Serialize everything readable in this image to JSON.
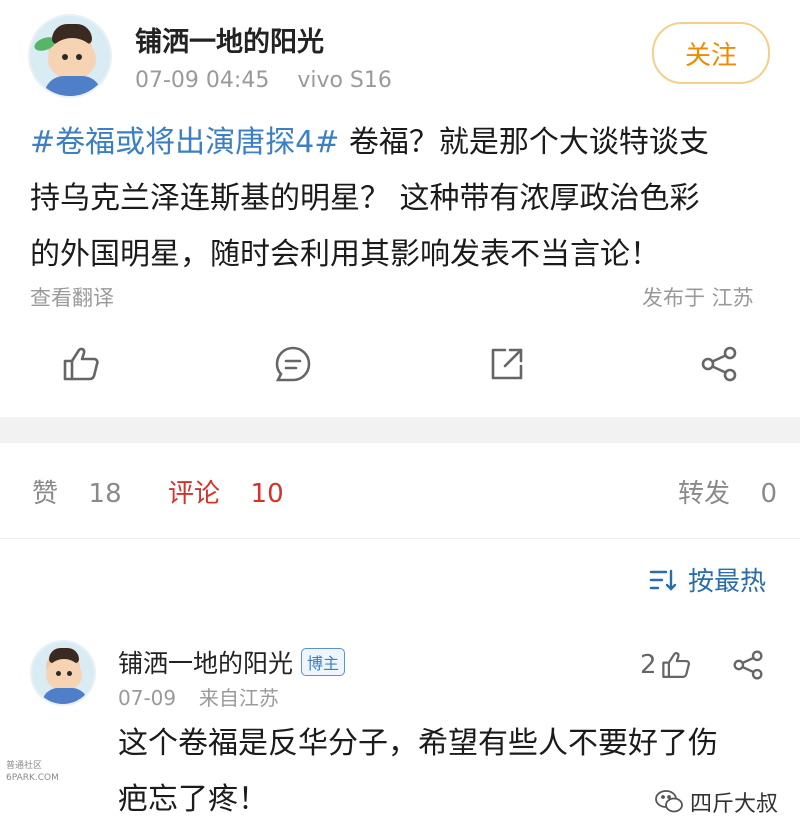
{
  "post": {
    "author": "铺洒一地的阳光",
    "time": "07-09 04:45",
    "device": "vivo S16",
    "follow_label": "关注",
    "hashtag": "#卷福或将出演唐探4#",
    "line1_rest": " 卷福？就是那个大谈特谈支",
    "line2": "持乌克兰泽连斯基的明星？ 这种带有浓厚政治色彩",
    "line3": "的外国明星，随时会利用其影响发表不当言论！",
    "translate_label": "查看翻译",
    "location": "发布于 江苏"
  },
  "actions": {
    "icons": [
      "like-icon",
      "comment-icon",
      "repost-icon",
      "share-icon"
    ]
  },
  "stats": {
    "likes_label": "赞",
    "likes_count": "18",
    "comments_label": "评论",
    "comments_count": "10",
    "reposts_label": "转发",
    "reposts_count": "0"
  },
  "sort": {
    "label": "按最热"
  },
  "comment": {
    "author": "铺洒一地的阳光",
    "badge": "博主",
    "date": "07-09",
    "source": "来自江苏",
    "like_count": "2",
    "line1": "这个卷福是反华分子，希望有些人不要好了伤",
    "line2": "疤忘了疼！"
  },
  "watermark": {
    "left_line1": "普通社区",
    "left_line2": "6PARK.COM",
    "right": "四斤大叔"
  },
  "colors": {
    "accent_blue": "#3c7fc2",
    "active_red": "#d4332a",
    "follow_orange": "#f08a00"
  }
}
